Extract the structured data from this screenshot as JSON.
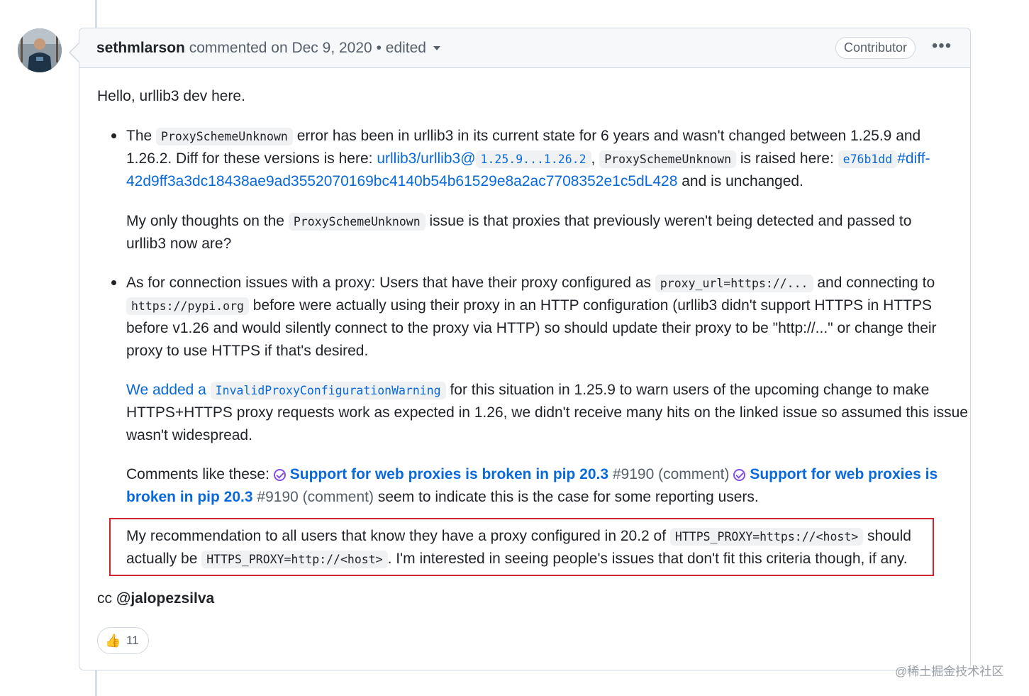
{
  "comment": {
    "author": "sethmlarson",
    "action": "commented on Dec 9, 2020",
    "separator": "•",
    "edited": "edited",
    "badge": "Contributor",
    "menu_icon": "kebab-horizontal-icon",
    "greeting": "Hello, urllib3 dev here.",
    "bullet1": {
      "l1_a": "The",
      "l1_code": "ProxySchemeUnknown",
      "l1_b": "error has been in urllib3 in its current state for 6 years and wasn't changed between 1.25.9 and",
      "l2_a": "1.26.2. Diff for these versions is here:",
      "l2_link": "urllib3/urllib3@",
      "l2_code_link": "1.25.9...1.26.2",
      "l2_comma": ",",
      "l2_code": "ProxySchemeUnknown",
      "l2_b": "is raised here:",
      "l2_hash": "e76b1dd",
      "l2_diff": "#diff-",
      "l3_link": "42d9ff3a3dc18438ae9ad3552070169bc4140b54b61529e8a2ac7708352e1c5dL428",
      "l3_b": "and is unchanged.",
      "p2_l1_a": "My only thoughts on the",
      "p2_l1_code": "ProxySchemeUnknown",
      "p2_l1_b": "issue is that proxies that previously weren't being detected and passed to",
      "p2_l2": "urllib3 now are?"
    },
    "bullet2": {
      "l1_a": "As for connection issues with a proxy: Users that have their proxy configured as",
      "l1_code": "proxy_url=https://...",
      "l1_b": "and connecting to",
      "l2_code": "https://pypi.org",
      "l2_b": "before were actually using their proxy in an HTTP configuration (urllib3 didn't support HTTPS in HTTPS",
      "l3": "before v1.26 and would silently connect to the proxy via HTTP) so should update their proxy to be \"http://...\" or change their",
      "l4": "proxy to use HTTPS if that's desired.",
      "p2_l1_link": "We added a",
      "p2_l1_code": "InvalidProxyConfigurationWarning",
      "p2_l1_b": "for this situation in 1.25.9 to warn users of the upcoming change to make",
      "p2_l2": "HTTPS+HTTPS proxy requests work as expected in 1.26, we didn't receive many hits on the linked issue so assumed this issue",
      "p2_l3": "wasn't widespread.",
      "p3_l1_a": "Comments like these:",
      "p3_issue_title": "Support for web proxies is broken in pip 20.3",
      "p3_issue_num": "#9190",
      "p3_issue_note": "(comment)",
      "p3_issue2_l1": "Support for web proxies is",
      "p3_issue2_l2": "broken in pip 20.3",
      "p3_l2_b": "seem to indicate this is the case for some reporting users.",
      "p4_l1_a": "My recommendation to all users that know they have a proxy configured in 20.2 of",
      "p4_l1_code": "HTTPS_PROXY=https://<host>",
      "p4_l1_b": "should",
      "p4_l2_a": "actually be",
      "p4_l2_code": "HTTPS_PROXY=http://<host>",
      "p4_l2_b": ". I'm interested in seeing people's issues that don't fit this criteria though, if any."
    },
    "cc_prefix": "cc",
    "cc_mention": "@jalopezsilva",
    "reaction": {
      "emoji": "👍",
      "count": "11"
    }
  },
  "watermark": "@稀土掘金技术社区",
  "colors": {
    "link": "#0969da",
    "highlight_border": "#d1242f",
    "issue_icon": "#8250df"
  }
}
